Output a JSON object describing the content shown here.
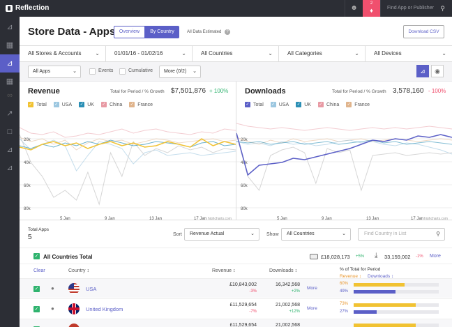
{
  "app": {
    "name": "Reflection",
    "alert_count": "2",
    "search_placeholder": "Find App or Publisher"
  },
  "sidebar": {
    "icons": [
      "chart-area-icon",
      "table-icon",
      "chart-area-icon",
      "grid-icon",
      "link-icon",
      "trend-icon",
      "chat-icon",
      "chart-area-icon",
      "chart-area-icon"
    ],
    "active_index": 2
  },
  "header": {
    "title": "Store Data - Apps",
    "tabs": [
      {
        "label": "Overview",
        "active": false
      },
      {
        "label": "By Country",
        "active": true
      }
    ],
    "estimated_note": "All Data Estimated",
    "csv_button": "Download CSV"
  },
  "filters": [
    {
      "label": "All Stores & Accounts"
    },
    {
      "label": "01/01/16 - 01/02/16"
    },
    {
      "label": "All Countries"
    },
    {
      "label": "All Categories"
    },
    {
      "label": "All Devices"
    }
  ],
  "controls": {
    "apps_select": "All Apps",
    "events_label": "Events",
    "cumulative_label": "Cumulative",
    "more_select": "More (0/2)"
  },
  "revenue_chart": {
    "title": "Revenue",
    "period_label": "Total for Period / % Growth",
    "total": "$7,501,876",
    "growth": "+ 100%",
    "legend": [
      {
        "name": "Total",
        "color": "#f1c232",
        "checked": true
      },
      {
        "name": "USA",
        "color": "#9cc7e0",
        "checked": false
      },
      {
        "name": "UK",
        "color": "#2b8fb5",
        "checked": true
      },
      {
        "name": "China",
        "color": "#e89aa4",
        "checked": false
      },
      {
        "name": "France",
        "color": "#e0b48c",
        "checked": false
      }
    ],
    "y_ticks": [
      "20k",
      "40k",
      "60k",
      "80k"
    ],
    "x_ticks": [
      "5 Jan",
      "9 Jan",
      "13 Jan",
      "17 Jan"
    ],
    "watermark": "highcharts.com"
  },
  "downloads_chart": {
    "title": "Downloads",
    "period_label": "Total for Period / % Growth",
    "total": "3,578,160",
    "growth": "- 100%",
    "legend": [
      {
        "name": "Total",
        "color": "#5b5fc7",
        "checked": true
      },
      {
        "name": "USA",
        "color": "#9cc7e0",
        "checked": false
      },
      {
        "name": "UK",
        "color": "#2b8fb5",
        "checked": true
      },
      {
        "name": "China",
        "color": "#e89aa4",
        "checked": false
      },
      {
        "name": "France",
        "color": "#e0b48c",
        "checked": false
      }
    ],
    "y_ticks": [
      "20k",
      "40k",
      "60k",
      "80k"
    ],
    "x_ticks": [
      "5 Jan",
      "9 Jan",
      "13 Jan",
      "17 Jan"
    ],
    "watermark": "highcharts.com"
  },
  "table": {
    "total_apps_label": "Total Apps",
    "total_apps_value": "5",
    "sort_label": "Sort",
    "sort_value": "Revenue Actual",
    "show_label": "Show",
    "show_value": "All Countries",
    "find_placeholder": "Find Country in List",
    "total_row": {
      "label": "All Countries Total",
      "revenue": "£18,028,173",
      "revenue_growth": "+5%",
      "downloads": "33,159,002",
      "downloads_growth": "-1%",
      "more": "More"
    },
    "headers": {
      "clear": "Clear",
      "country": "Country",
      "revenue": "Revenue",
      "downloads": "Downloads",
      "pct_title": "% of Total for Period",
      "pct_revenue": "Revenue",
      "pct_downloads": "Downloads"
    },
    "rows": [
      {
        "country": "USA",
        "revenue": "£10,843,002",
        "revenue_growth": "-3%",
        "downloads": "16,342,568",
        "downloads_growth": "+2%",
        "more": "More",
        "rev_pct": "60%",
        "rev_fraction": 0.6,
        "dl_pct": "49%",
        "dl_fraction": 0.49
      },
      {
        "country": "United Kingdom",
        "revenue": "£11,529,654",
        "revenue_growth": "-7%",
        "downloads": "21,002,568",
        "downloads_growth": "+12%",
        "more": "More",
        "rev_pct": "73%",
        "rev_fraction": 0.73,
        "dl_pct": "27%",
        "dl_fraction": 0.27
      },
      {
        "country": "",
        "revenue": "£11,529,654",
        "revenue_growth": "",
        "downloads": "21,002,568",
        "downloads_growth": "",
        "more": "",
        "rev_pct": "",
        "rev_fraction": 0.73,
        "dl_pct": "",
        "dl_fraction": 0.27
      }
    ]
  },
  "colors": {
    "accent": "#5b5fc7",
    "positive": "#2fb36e",
    "negative": "#f0506e",
    "revenue_bar": "#f1c232",
    "downloads_bar": "#5b5fc7"
  }
}
